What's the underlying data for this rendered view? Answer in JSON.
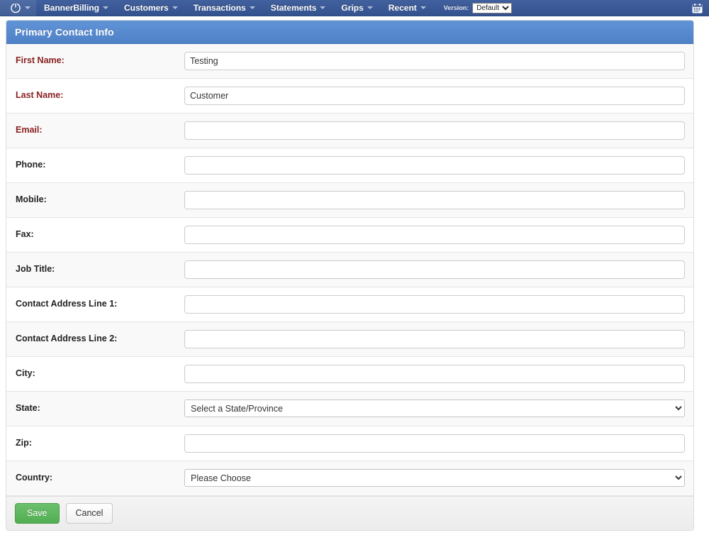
{
  "navbar": {
    "brand_icon": "power-icon",
    "menus": [
      {
        "label": "BannerBilling",
        "has_caret": true
      },
      {
        "label": "Customers",
        "has_caret": true
      },
      {
        "label": "Transactions",
        "has_caret": true
      },
      {
        "label": "Statements",
        "has_caret": true
      },
      {
        "label": "Grips",
        "has_caret": true
      },
      {
        "label": "Recent",
        "has_caret": true
      }
    ],
    "version_label": "Version:",
    "version_value": "Default",
    "version_options": [
      "Default"
    ],
    "right_icon": "calendar-icon"
  },
  "panel": {
    "title": "Primary Contact Info",
    "accent_color": "#5b8bd0",
    "required_label_color": "#8a1f1f"
  },
  "form": {
    "fields": [
      {
        "label": "First Name:",
        "type": "text",
        "value": "Testing",
        "placeholder": "",
        "required": true
      },
      {
        "label": "Last Name:",
        "type": "text",
        "value": "Customer",
        "placeholder": "",
        "required": true
      },
      {
        "label": "Email:",
        "type": "text",
        "value": "",
        "placeholder": "",
        "required": true
      },
      {
        "label": "Phone:",
        "type": "text",
        "value": "",
        "placeholder": "",
        "required": false
      },
      {
        "label": "Mobile:",
        "type": "text",
        "value": "",
        "placeholder": "",
        "required": false
      },
      {
        "label": "Fax:",
        "type": "text",
        "value": "",
        "placeholder": "",
        "required": false
      },
      {
        "label": "Job Title:",
        "type": "text",
        "value": "",
        "placeholder": "",
        "required": false
      },
      {
        "label": "Contact Address Line 1:",
        "type": "text",
        "value": "",
        "placeholder": "",
        "required": false
      },
      {
        "label": "Contact Address Line 2:",
        "type": "text",
        "value": "",
        "placeholder": "",
        "required": false
      },
      {
        "label": "City:",
        "type": "text",
        "value": "",
        "placeholder": "",
        "required": false
      },
      {
        "label": "State:",
        "type": "select",
        "value": "Select a State/Province",
        "options": [
          "Select a State/Province"
        ],
        "required": false
      },
      {
        "label": "Zip:",
        "type": "text",
        "value": "",
        "placeholder": "",
        "required": false
      },
      {
        "label": "Country:",
        "type": "select",
        "value": "Please Choose",
        "options": [
          "Please Choose"
        ],
        "required": false
      }
    ]
  },
  "footer": {
    "save_label": "Save",
    "cancel_label": "Cancel",
    "save_color": "#5cb85c"
  }
}
